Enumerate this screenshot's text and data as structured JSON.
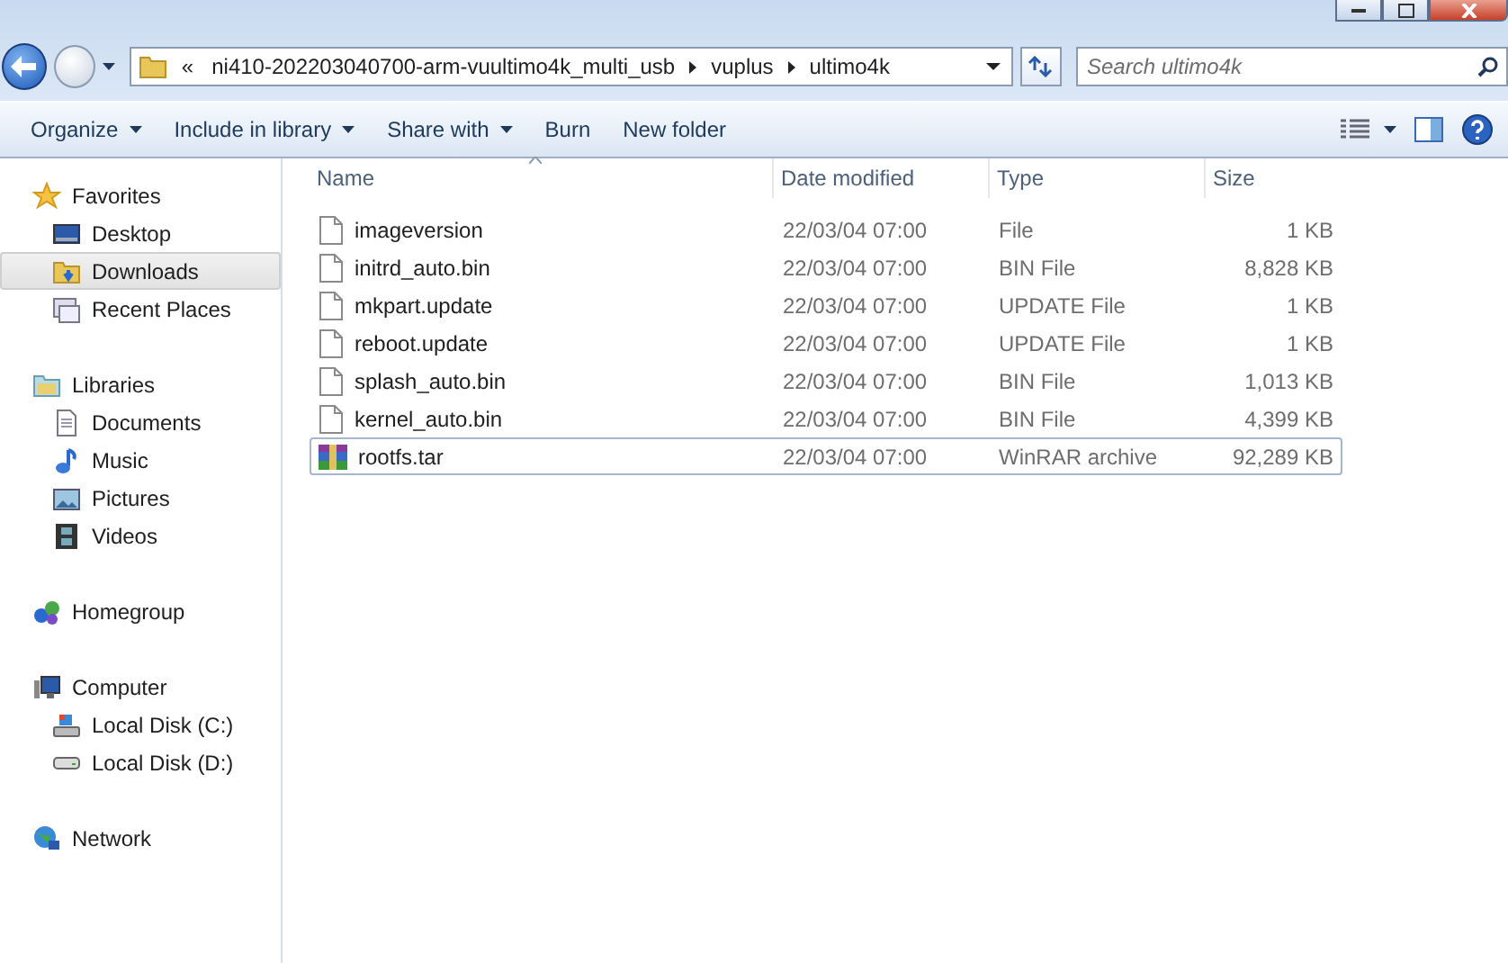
{
  "address": {
    "overflow": "«",
    "crumbs": [
      "ni410-202203040700-arm-vuultimo4k_multi_usb",
      "vuplus",
      "ultimo4k"
    ]
  },
  "search": {
    "placeholder": "Search ultimo4k"
  },
  "toolbar": {
    "items": [
      {
        "label": "Organize",
        "menu": true
      },
      {
        "label": "Include in library",
        "menu": true
      },
      {
        "label": "Share with",
        "menu": true
      },
      {
        "label": "Burn",
        "menu": false
      },
      {
        "label": "New folder",
        "menu": false
      }
    ]
  },
  "sidebar": {
    "groups": [
      {
        "label": "Favorites",
        "kind": "star",
        "children": [
          {
            "label": "Desktop",
            "kind": "desktop",
            "selected": false
          },
          {
            "label": "Downloads",
            "kind": "downloads",
            "selected": true
          },
          {
            "label": "Recent Places",
            "kind": "recent",
            "selected": false
          }
        ]
      },
      {
        "label": "Libraries",
        "kind": "library",
        "children": [
          {
            "label": "Documents",
            "kind": "document",
            "selected": false
          },
          {
            "label": "Music",
            "kind": "music",
            "selected": false
          },
          {
            "label": "Pictures",
            "kind": "pictures",
            "selected": false
          },
          {
            "label": "Videos",
            "kind": "videos",
            "selected": false
          }
        ]
      },
      {
        "label": "Homegroup",
        "kind": "homegroup"
      },
      {
        "label": "Computer",
        "kind": "computer",
        "children": [
          {
            "label": "Local Disk (C:)",
            "kind": "systemdisk",
            "selected": false
          },
          {
            "label": "Local Disk (D:)",
            "kind": "disk",
            "selected": false
          }
        ]
      },
      {
        "label": "Network",
        "kind": "network"
      }
    ]
  },
  "table": {
    "columns": [
      "Name",
      "Date modified",
      "Type",
      "Size"
    ],
    "rows": [
      {
        "name": "imageversion",
        "date": "22/03/04 07:00",
        "type": "File",
        "size": "1 KB",
        "kind": "file",
        "focused": false
      },
      {
        "name": "initrd_auto.bin",
        "date": "22/03/04 07:00",
        "type": "BIN File",
        "size": "8,828 KB",
        "kind": "file",
        "focused": false
      },
      {
        "name": "mkpart.update",
        "date": "22/03/04 07:00",
        "type": "UPDATE File",
        "size": "1 KB",
        "kind": "file",
        "focused": false
      },
      {
        "name": "reboot.update",
        "date": "22/03/04 07:00",
        "type": "UPDATE File",
        "size": "1 KB",
        "kind": "file",
        "focused": false
      },
      {
        "name": "splash_auto.bin",
        "date": "22/03/04 07:00",
        "type": "BIN File",
        "size": "1,013 KB",
        "kind": "file",
        "focused": false
      },
      {
        "name": "kernel_auto.bin",
        "date": "22/03/04 07:00",
        "type": "BIN File",
        "size": "4,399 KB",
        "kind": "file",
        "focused": false
      },
      {
        "name": "rootfs.tar",
        "date": "22/03/04 07:00",
        "type": "WinRAR archive",
        "size": "92,289 KB",
        "kind": "archive",
        "focused": true
      }
    ]
  }
}
